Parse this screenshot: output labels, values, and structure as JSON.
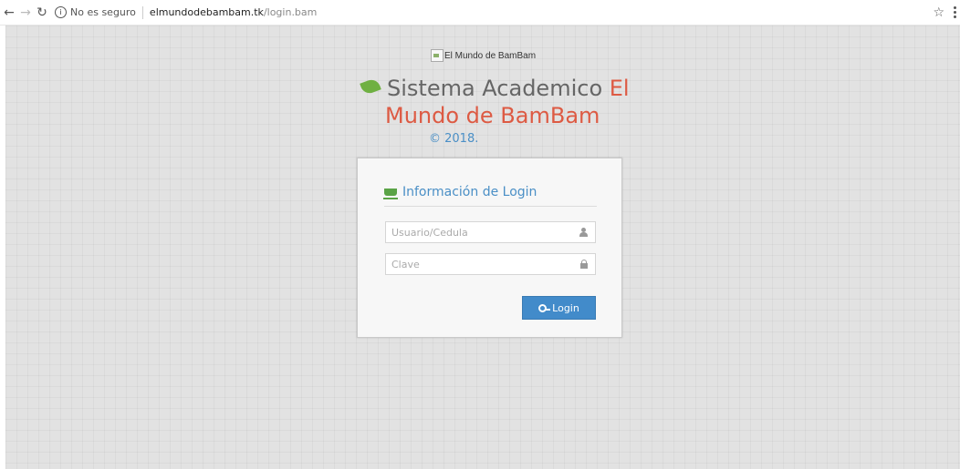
{
  "browser": {
    "security_text": "No es seguro",
    "url_host": "elmundodebambam.tk",
    "url_path": "/login.bam"
  },
  "logo": {
    "alt": "El Mundo de BamBam"
  },
  "heading": {
    "title_part1": "Sistema Academico",
    "title_part2": "El",
    "title_line2": "Mundo de BamBam",
    "copyright": "© 2018."
  },
  "login": {
    "title": "Información de Login",
    "username_placeholder": "Usuario/Cedula",
    "password_placeholder": "Clave",
    "button_label": "Login"
  },
  "colors": {
    "accent_red": "#dd5a43",
    "link_blue": "#4a8fc6",
    "button_blue": "#428bca",
    "leaf_green": "#6fb042"
  }
}
